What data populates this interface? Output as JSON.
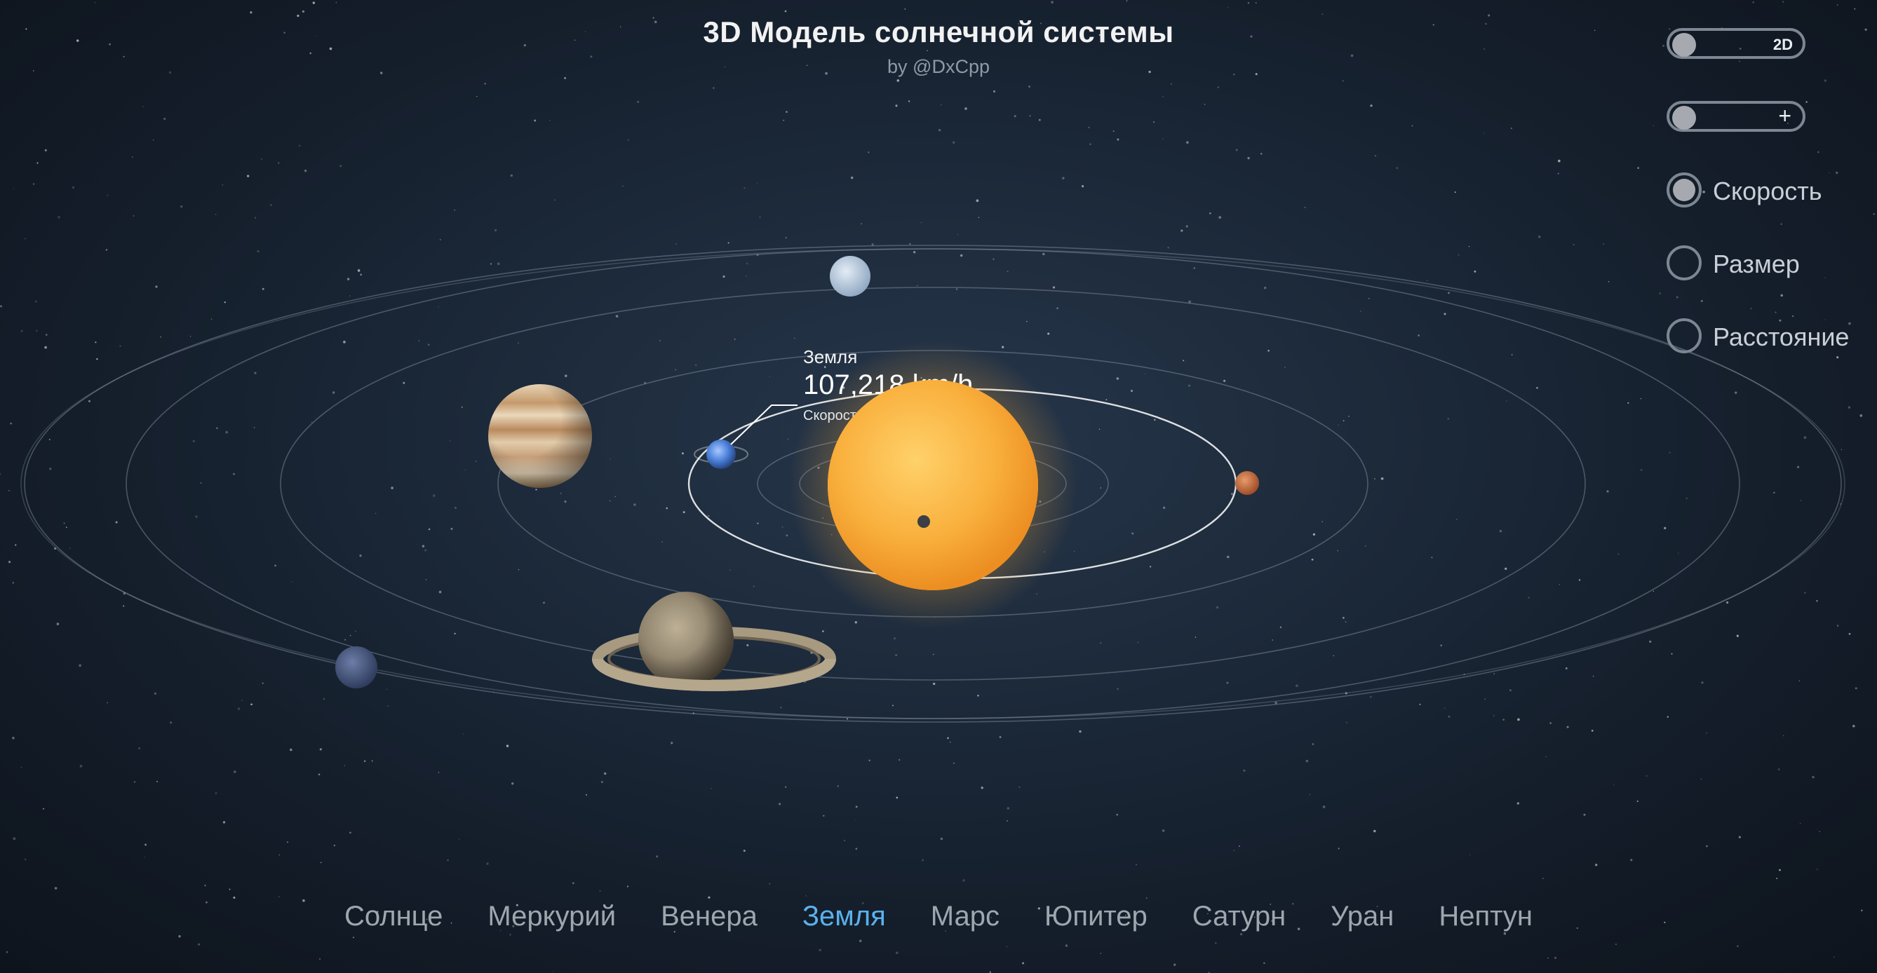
{
  "header": {
    "title": "3D Модель солнечной системы",
    "subtitle": "by @DxCpp"
  },
  "controls": {
    "view_toggle": {
      "label": "2D",
      "on": false
    },
    "zoom_toggle": {
      "label": "+",
      "on": false
    },
    "modes": [
      {
        "label": "Скорость",
        "selected": true
      },
      {
        "label": "Размер",
        "selected": false
      },
      {
        "label": "Расстояние",
        "selected": false
      }
    ]
  },
  "info": {
    "planet": "Земля",
    "value": "107,218 km/h",
    "caption": "Скорость"
  },
  "nav": {
    "items": [
      "Солнце",
      "Меркурий",
      "Венера",
      "Земля",
      "Марс",
      "Юпитер",
      "Сатурн",
      "Уран",
      "Нептун"
    ],
    "active": "Земля"
  },
  "colors": {
    "sun": "#f9b03d",
    "earth": "#4a7fd8",
    "mars": "#c56a3c",
    "jupiter": "#cfb08a",
    "saturn": "#9a8b70",
    "uranus": "#b8cbe0",
    "neptune": "#44537a",
    "active_nav": "#5ab2ee",
    "orbit": "#8a97a6"
  }
}
